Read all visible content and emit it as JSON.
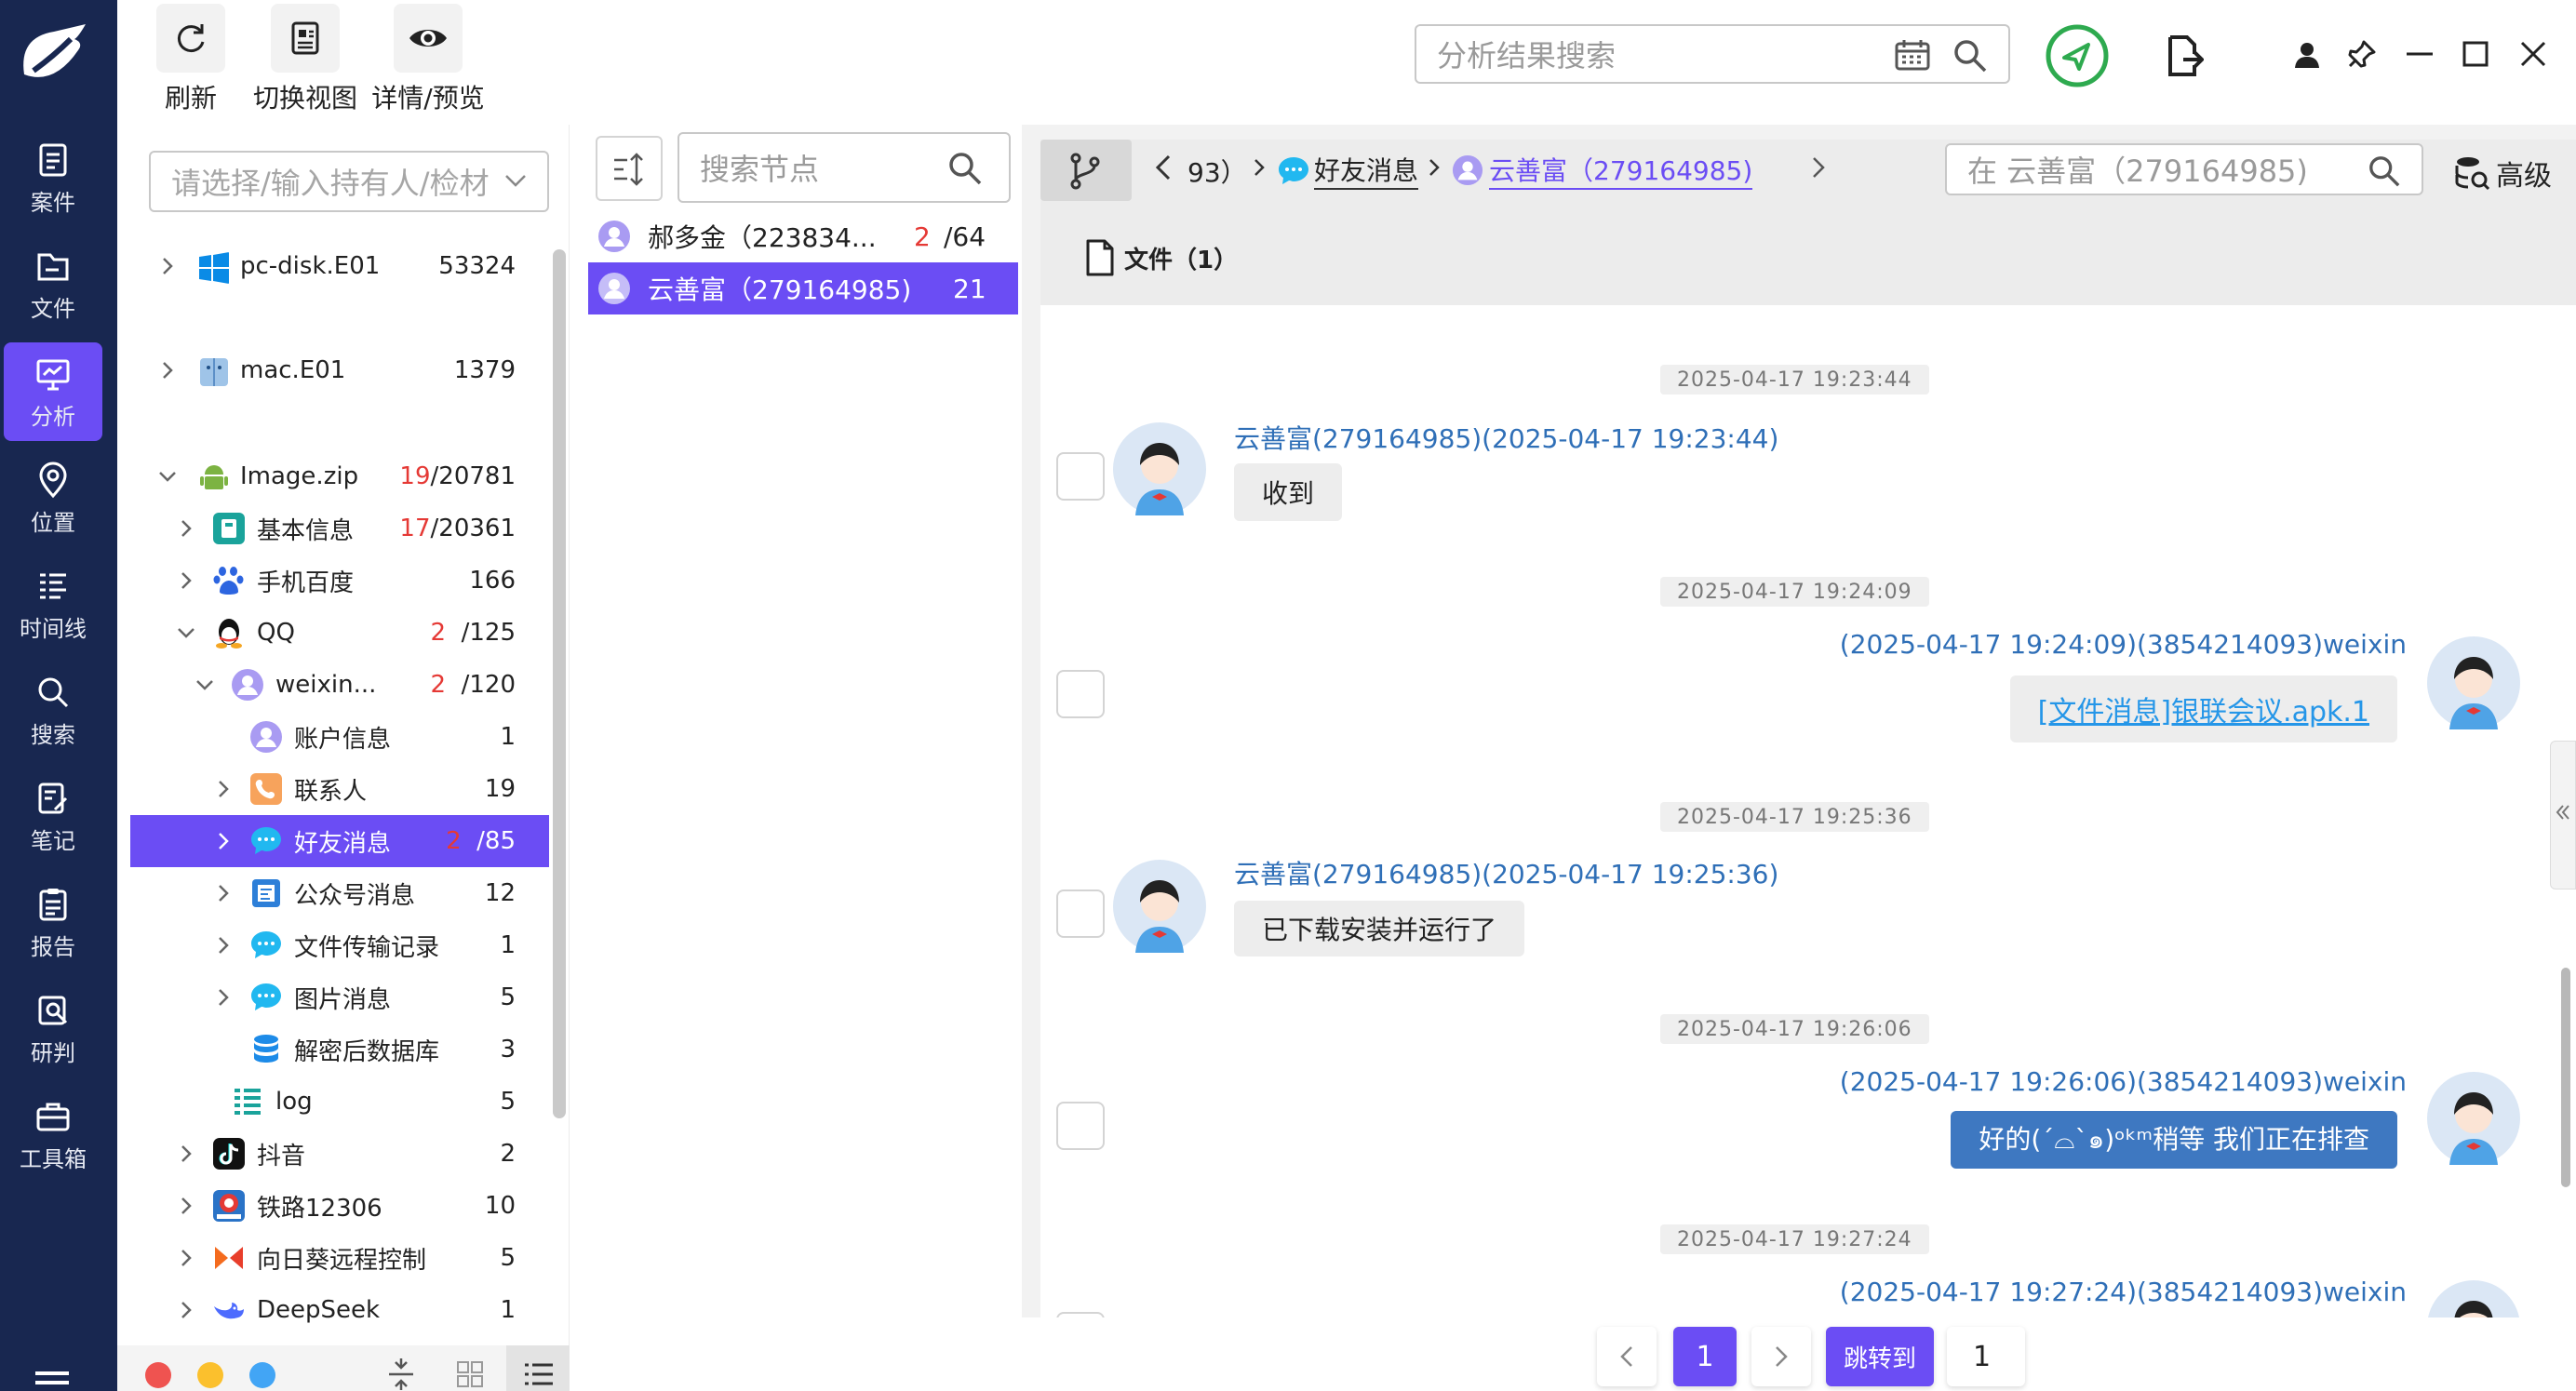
{
  "nav": {
    "items": [
      {
        "key": "case",
        "label": "案件"
      },
      {
        "key": "file",
        "label": "文件"
      },
      {
        "key": "analysis",
        "label": "分析"
      },
      {
        "key": "location",
        "label": "位置"
      },
      {
        "key": "timeline",
        "label": "时间线"
      },
      {
        "key": "search",
        "label": "搜索"
      },
      {
        "key": "notes",
        "label": "笔记"
      },
      {
        "key": "report",
        "label": "报告"
      },
      {
        "key": "judge",
        "label": "研判"
      },
      {
        "key": "toolbox",
        "label": "工具箱"
      }
    ],
    "active": "分析"
  },
  "toolbar": {
    "refresh": "刷新",
    "switch_view": "切换视图",
    "detail_preview": "详情/预览"
  },
  "search": {
    "placeholder": "分析结果搜索"
  },
  "holder": {
    "placeholder": "请选择/输入持有人/检材"
  },
  "tree": {
    "items": [
      {
        "label": "pc-disk.E01",
        "count": "53324",
        "red": ""
      },
      {
        "label": "mac.E01",
        "count": "1379",
        "red": ""
      },
      {
        "label": "Image.zip",
        "count": "/20781",
        "red": "19"
      },
      {
        "label": "基本信息",
        "count": "/20361",
        "red": "17"
      },
      {
        "label": "手机百度",
        "count": "166",
        "red": ""
      },
      {
        "label": "QQ",
        "count": "/125",
        "red": "2"
      },
      {
        "label": "weixin...",
        "count": "/120",
        "red": "2"
      },
      {
        "label": "账户信息",
        "count": "1",
        "red": ""
      },
      {
        "label": "联系人",
        "count": "19",
        "red": ""
      },
      {
        "label": "好友消息",
        "count": "/85",
        "red": "2"
      },
      {
        "label": "公众号消息",
        "count": "12",
        "red": ""
      },
      {
        "label": "文件传输记录",
        "count": "1",
        "red": ""
      },
      {
        "label": "图片消息",
        "count": "5",
        "red": ""
      },
      {
        "label": "解密后数据库",
        "count": "3",
        "red": ""
      },
      {
        "label": "log",
        "count": "5",
        "red": ""
      },
      {
        "label": "抖音",
        "count": "2",
        "red": ""
      },
      {
        "label": "铁路12306",
        "count": "10",
        "red": ""
      },
      {
        "label": "向日葵远程控制",
        "count": "5",
        "red": ""
      },
      {
        "label": "DeepSeek",
        "count": "1",
        "red": ""
      }
    ]
  },
  "nodes": {
    "placeholder": "搜索节点",
    "items": [
      {
        "name": "郝多金（223834...",
        "red": "2",
        "count": "/64"
      },
      {
        "name": "云善富（279164985)",
        "red": "",
        "count": "21"
      }
    ]
  },
  "breadcrumb": {
    "prev": "93）",
    "item1": "好友消息",
    "item2": "云善富（279164985)"
  },
  "conv_search": {
    "placeholder": "在 云善富（279164985)"
  },
  "advanced": "高级",
  "tab": {
    "label": "文件（1）"
  },
  "messages": [
    {
      "time": "2025-04-17 19:23:44",
      "meta": "云善富(279164985)(2025-04-17 19:23:44)",
      "text": "收到",
      "side": "left"
    },
    {
      "time": "2025-04-17 19:24:09",
      "meta": "(2025-04-17 19:24:09)(3854214093)weixin",
      "text": "[文件消息]银联会议.apk.1",
      "side": "right"
    },
    {
      "time": "2025-04-17 19:25:36",
      "meta": "云善富(279164985)(2025-04-17 19:25:36)",
      "text": "已下载安装并运行了",
      "side": "left"
    },
    {
      "time": "2025-04-17 19:26:06",
      "meta": "(2025-04-17 19:26:06)(3854214093)weixin",
      "text": "好的(ˊ⌓ˋ๑)ᵒᵏᵐ稍等 我们正在排查",
      "side": "right"
    },
    {
      "time": "2025-04-17 19:27:24",
      "meta": "(2025-04-17 19:27:24)(3854214093)weixin",
      "text": "",
      "side": "right"
    }
  ],
  "pager": {
    "current": "1",
    "jump_label": "跳转到",
    "jump_value": "1"
  },
  "colors": {
    "nav_bg": "#182750",
    "accent": "#6b4df4",
    "link": "#2f6fb7",
    "bubble_blue": "#3e78c1"
  }
}
